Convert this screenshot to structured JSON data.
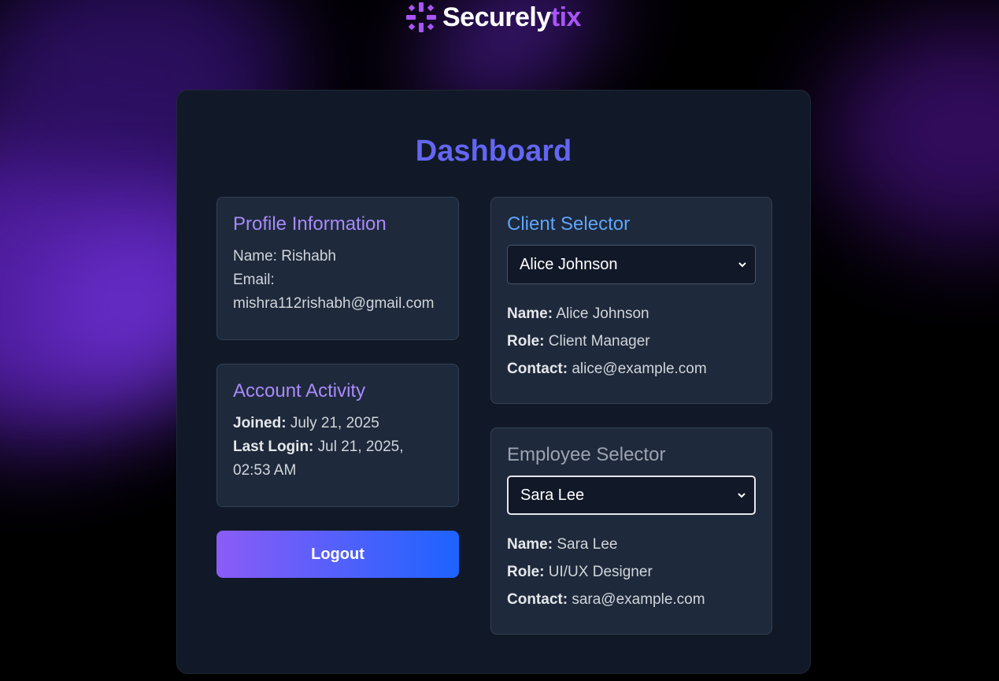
{
  "brand": {
    "name_main": "Securely",
    "name_accent": "tix",
    "accent_color": "#a855f7"
  },
  "page_title": "Dashboard",
  "profile": {
    "title": "Profile Information",
    "name_line": "Name: Rishabh",
    "email_label": "Email:",
    "email_value": "mishra112rishabh@gmail.com"
  },
  "activity": {
    "title": "Account Activity",
    "joined_label": "Joined:",
    "joined_value": "July 21, 2025",
    "last_login_label": "Last Login:",
    "last_login_value": "Jul 21, 2025, 02:53 AM"
  },
  "logout_label": "Logout",
  "client_selector": {
    "title": "Client Selector",
    "selected": "Alice Johnson",
    "name_label": "Name:",
    "name_value": "Alice Johnson",
    "role_label": "Role:",
    "role_value": "Client Manager",
    "contact_label": "Contact:",
    "contact_value": "alice@example.com"
  },
  "employee_selector": {
    "title": "Employee Selector",
    "selected": "Sara Lee",
    "name_label": "Name:",
    "name_value": "Sara Lee",
    "role_label": "Role:",
    "role_value": "UI/UX Designer",
    "contact_label": "Contact:",
    "contact_value": "sara@example.com"
  },
  "colors": {
    "title": "#6366f1",
    "purple_heading": "#a78bfa",
    "blue_heading": "#60a5fa",
    "gray_heading": "#9ca3af",
    "logout_gradient_start": "#8b5cf6",
    "logout_gradient_end": "#1d63ff"
  }
}
